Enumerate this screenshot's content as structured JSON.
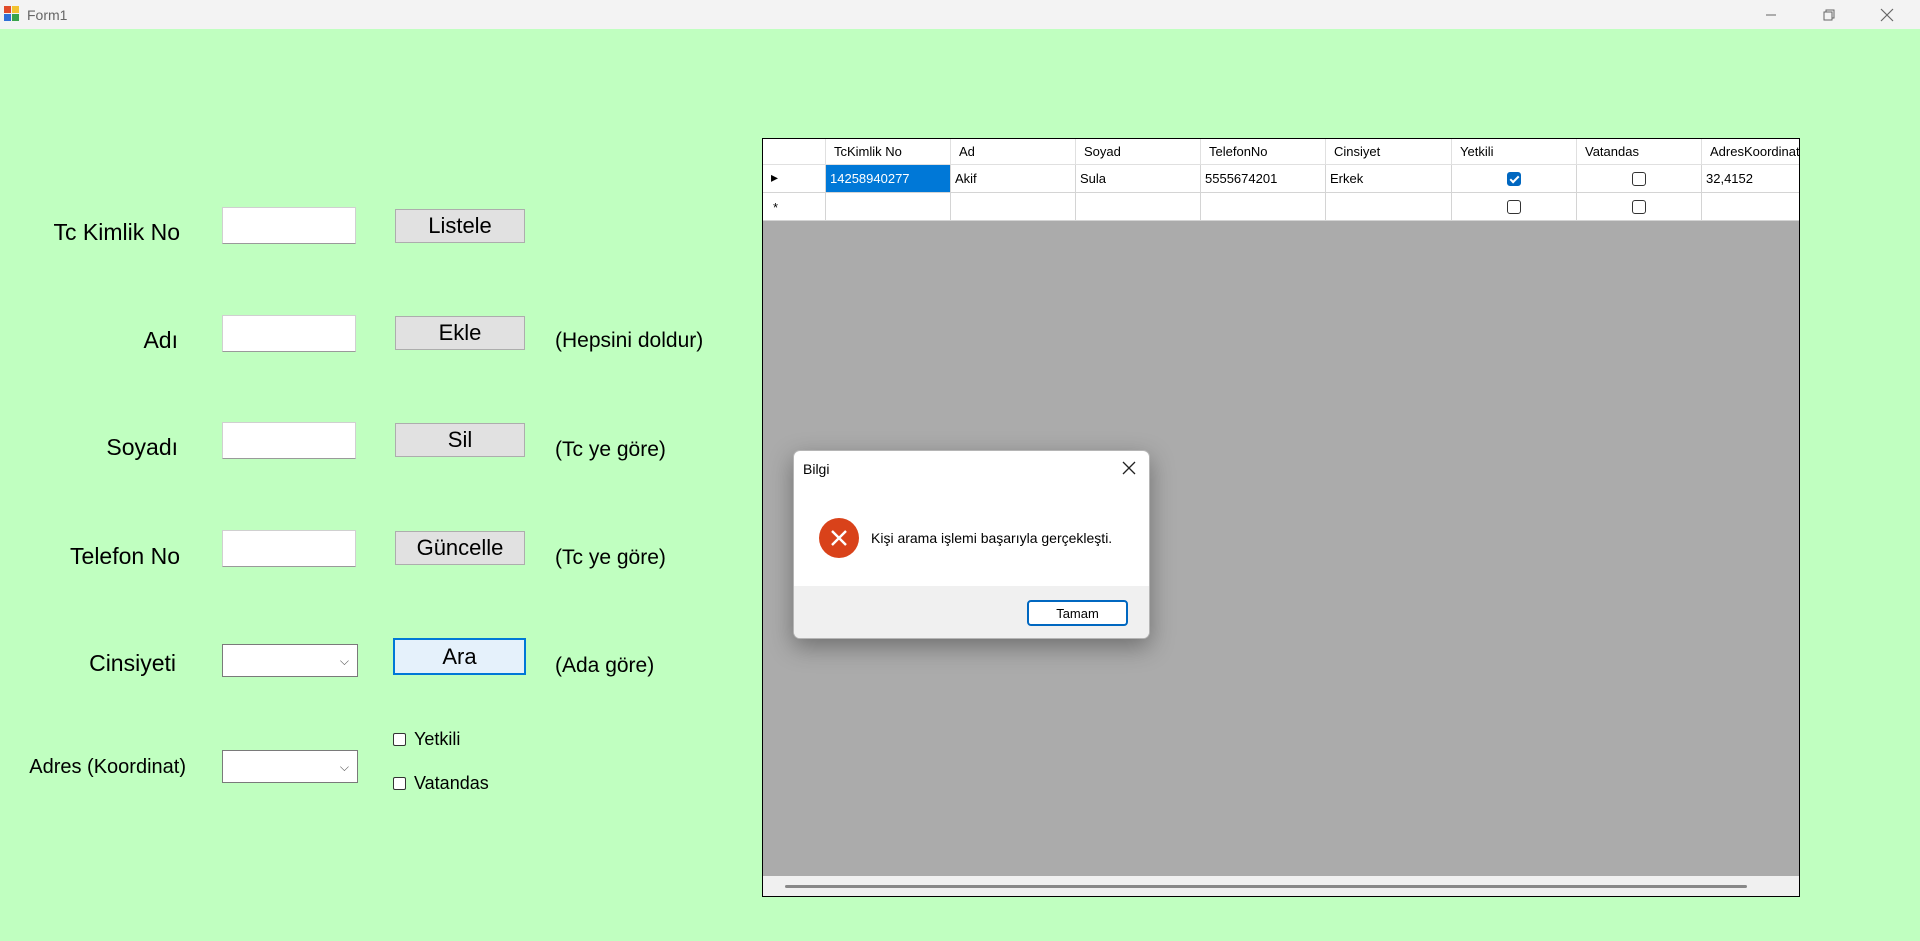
{
  "window": {
    "title": "Form1"
  },
  "form": {
    "labels": {
      "tc": "Tc Kimlik No",
      "ad": "Adı",
      "soyad": "Soyadı",
      "telefon": "Telefon No",
      "cinsiyet": "Cinsiyeti",
      "adres": "Adres (Koordinat)"
    },
    "buttons": {
      "listele": "Listele",
      "ekle": "Ekle",
      "sil": "Sil",
      "guncelle": "Güncelle",
      "ara": "Ara"
    },
    "notes": {
      "ekle": "(Hepsini doldur)",
      "sil": "(Tc ye göre)",
      "guncelle": "(Tc ye göre)",
      "ara": "(Ada göre)"
    },
    "inputs": {
      "tc": "",
      "ad": "",
      "soyad": "",
      "telefon": ""
    },
    "combos": {
      "cinsiyet": "",
      "adres": ""
    },
    "checkboxes": {
      "yetkili": {
        "label": "Yetkili",
        "checked": false
      },
      "vatandas": {
        "label": "Vatandas",
        "checked": false
      }
    }
  },
  "grid": {
    "columns": [
      "TcKimlik No",
      "Ad",
      "Soyad",
      "TelefonNo",
      "Cinsiyet",
      "Yetkili",
      "Vatandas",
      "AdresKoordinat"
    ],
    "rows": [
      {
        "tc": "14258940277",
        "ad": "Akif",
        "soyad": "Sula",
        "telefon": "5555674201",
        "cinsiyet": "Erkek",
        "yetkili": true,
        "vatandas": false,
        "adres": "32,4152"
      }
    ],
    "new_row_marker": "*",
    "current_row_marker": "▸"
  },
  "dialog": {
    "title": "Bilgi",
    "message": "Kişi arama işlemi başarıyla gerçekleşti.",
    "ok_label": "Tamam",
    "icon": "error-icon"
  }
}
